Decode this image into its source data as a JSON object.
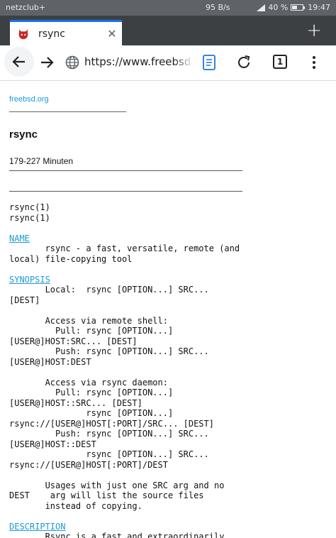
{
  "status_bar": {
    "carrier": "netzclub+",
    "speed": "95 B/s",
    "battery": "40 %",
    "battery_level": 0.4,
    "time": "19:47"
  },
  "tab": {
    "title": "rsync",
    "favicon": "freebsd-daemon-icon",
    "close": "✕",
    "new_tab": "+"
  },
  "toolbar": {
    "url": "https://www.freebsd.org",
    "tab_count": "1"
  },
  "page": {
    "site_link": "freebsd.org",
    "title": "rsync",
    "duration": "179-227 Minuten",
    "man_header": [
      "rsync(1)",
      "rsync(1)"
    ],
    "sections": [
      {
        "heading": "NAME",
        "lines": [
          "       rsync - a fast, versatile, remote (and",
          "local) file-copying tool"
        ]
      },
      {
        "heading": "SYNOPSIS",
        "lines": [
          "       Local:  rsync [OPTION...] SRC...",
          "[DEST]",
          "",
          "       Access via remote shell:",
          "         Pull: rsync [OPTION...]",
          "[USER@]HOST:SRC... [DEST]",
          "         Push: rsync [OPTION...] SRC...",
          "[USER@]HOST:DEST",
          "",
          "       Access via rsync daemon:",
          "         Pull: rsync [OPTION...]",
          "[USER@]HOST::SRC... [DEST]",
          "               rsync [OPTION...]",
          "rsync://[USER@]HOST[:PORT]/SRC... [DEST]",
          "         Push: rsync [OPTION...] SRC...",
          "[USER@]HOST::DEST",
          "               rsync [OPTION...] SRC...",
          "rsync://[USER@]HOST[:PORT]/DEST",
          "",
          "       Usages with just one SRC arg and no",
          "DEST    arg will list the source files",
          "       instead of copying."
        ]
      },
      {
        "heading": "DESCRIPTION",
        "lines": [
          "       Rsync is a fast and extraordinarily"
        ]
      }
    ]
  },
  "colors": {
    "link": "#1a9bd7",
    "tab_accent": "#1a73e8",
    "tabstrip": "#3c4043",
    "statusbar": "#5f6368"
  }
}
